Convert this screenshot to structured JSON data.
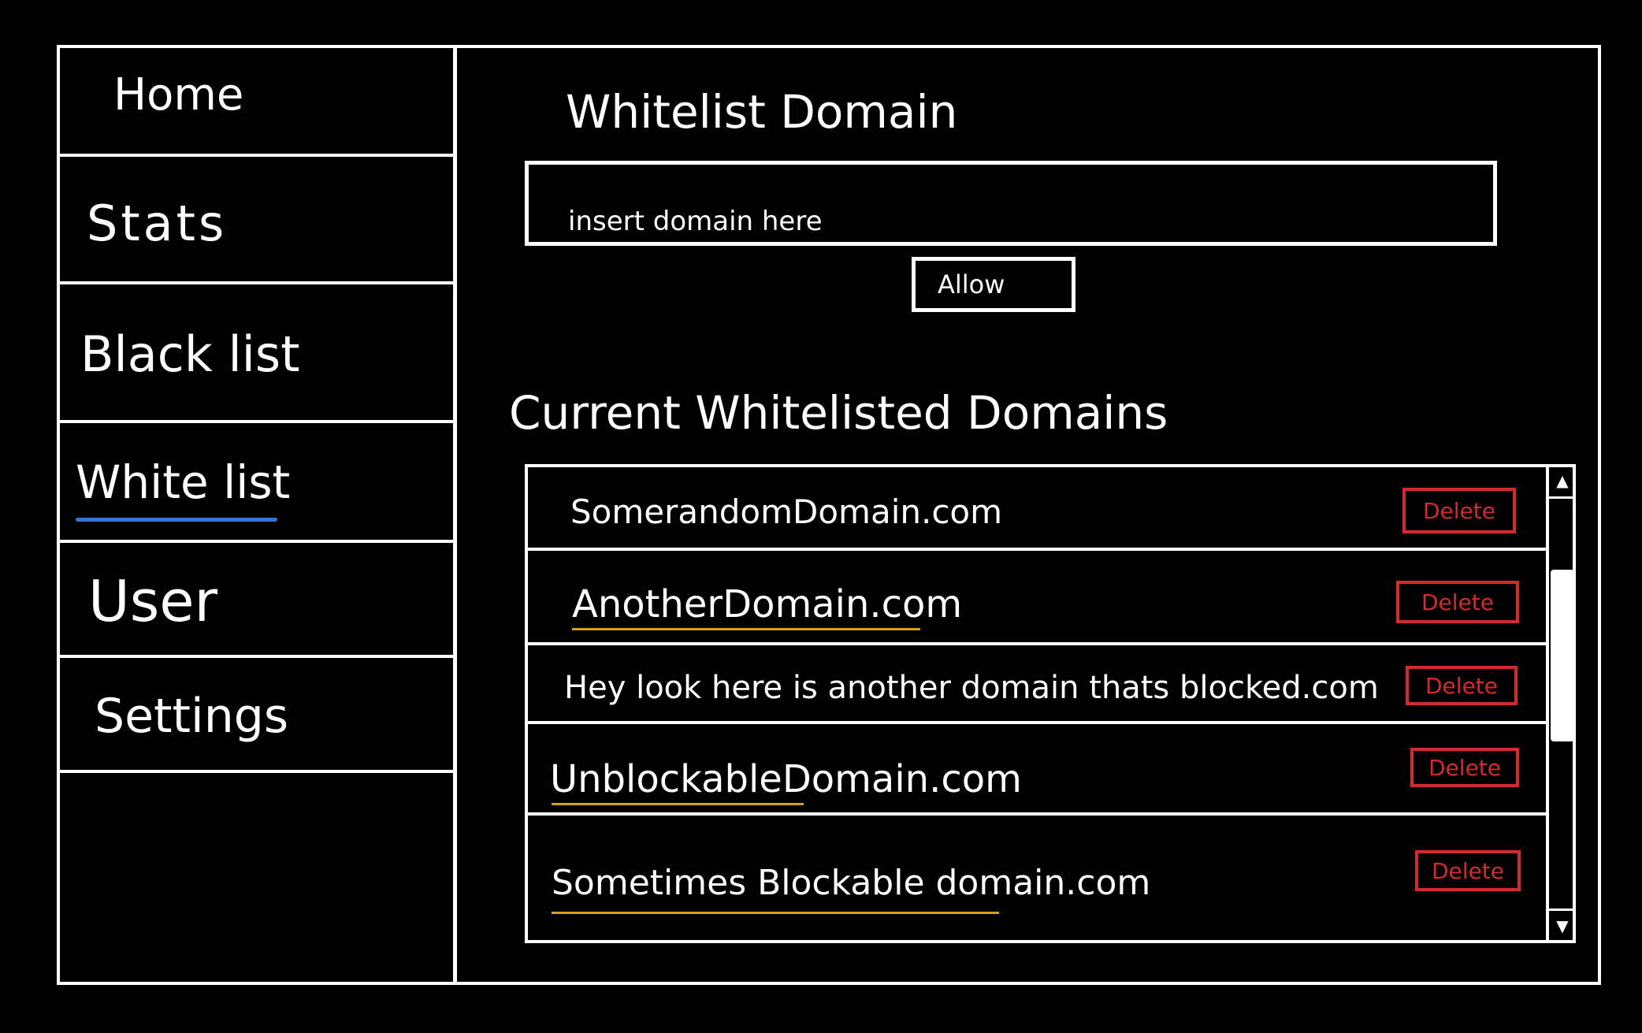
{
  "sidebar": {
    "items": [
      {
        "label": "Home"
      },
      {
        "label": "Stats"
      },
      {
        "label": "Black list"
      },
      {
        "label": "White list",
        "active": true
      },
      {
        "label": "User"
      },
      {
        "label": "Settings"
      }
    ],
    "active_indicator_color": "#3d6fd6"
  },
  "whitelist_form": {
    "title": "Whitelist Domain",
    "input_placeholder": "insert domain here",
    "allow_label": "Allow"
  },
  "current_list": {
    "title": "Current Whitelisted Domains",
    "rows": [
      {
        "domain": "SomerandomDomain.com",
        "delete_label": "Delete"
      },
      {
        "domain": "AnotherDomain.com",
        "delete_label": "Delete"
      },
      {
        "domain": "Hey look here is another domain thats blocked.com",
        "delete_label": "Delete"
      },
      {
        "domain": "UnblockableDomain.com",
        "delete_label": "Delete"
      },
      {
        "domain": "Sometimes Blockable domain.com",
        "delete_label": "Delete"
      }
    ],
    "delete_color": "#d42a2a",
    "highlight_underline_color": "#d4a017",
    "scroll_up_icon": "▲",
    "scroll_down_icon": "▼"
  }
}
